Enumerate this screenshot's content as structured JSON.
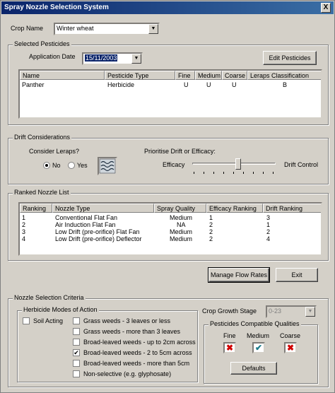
{
  "window": {
    "title": "Spray Nozzle Selection System",
    "close_label": "X"
  },
  "crop": {
    "label": "Crop Name",
    "value": "Winter wheat"
  },
  "selected_pesticides": {
    "group_title": "Selected Pesticides",
    "application_date_label": "Application Date",
    "application_date_value": "15/11/2003",
    "edit_button": "Edit Pesticides",
    "columns": [
      "Name",
      "Pesticide Type",
      "Fine",
      "Medium",
      "Coarse",
      "Leraps Classification"
    ],
    "rows": [
      [
        "Panther",
        "Herbicide",
        "U",
        "U",
        "U",
        "B"
      ]
    ]
  },
  "drift": {
    "group_title": "Drift Considerations",
    "consider_leraps_label": "Consider Leraps?",
    "no_label": "No",
    "yes_label": "Yes",
    "selected": "No",
    "prioritise_label": "Prioritise Drift or Efficacy:",
    "efficacy_label": "Efficacy",
    "drift_control_label": "Drift Control",
    "slider_position": 0.55
  },
  "ranked": {
    "group_title": "Ranked Nozzle List",
    "columns": [
      "Ranking",
      "Nozzle Type",
      "Spray Quality",
      "Efficacy Ranking",
      "Drift Ranking"
    ],
    "rows": [
      [
        "1",
        "Conventional Flat Fan",
        "Medium",
        "1",
        "3"
      ],
      [
        "2",
        "Air Induction Flat Fan",
        "NA",
        "2",
        "1"
      ],
      [
        "3",
        "Low Drift (pre-orifice) Flat Fan",
        "Medium",
        "2",
        "2"
      ],
      [
        "4",
        "Low Drift (pre-orifice) Deflector",
        "Medium",
        "2",
        "4"
      ]
    ]
  },
  "actions": {
    "manage_flow_rates": "Manage Flow Rates",
    "exit": "Exit"
  },
  "criteria": {
    "group_title": "Nozzle Selection Criteria",
    "herbicide_group_title": "Herbicide Modes of Action",
    "soil_acting_label": "Soil Acting",
    "soil_acting_checked": false,
    "modes": [
      {
        "label": "Grass weeds - 3 leaves or less",
        "checked": false
      },
      {
        "label": "Grass weeds - more than 3 leaves",
        "checked": false
      },
      {
        "label": "Broad-leaved weeds - up to 2cm across",
        "checked": false
      },
      {
        "label": "Broad-leaved weeds - 2 to 5cm across",
        "checked": true
      },
      {
        "label": "Broad-leaved weeds - more than 5cm",
        "checked": false
      },
      {
        "label": "Non-selective (e.g. glyphosate)",
        "checked": false
      }
    ],
    "crop_growth_stage_label": "Crop Growth Stage",
    "crop_growth_stage_value": "0-23",
    "compatible_group_title": "Pesticides Compatible Qualities",
    "qualities": [
      {
        "label": "Fine",
        "state": "cross"
      },
      {
        "label": "Medium",
        "state": "tick"
      },
      {
        "label": "Coarse",
        "state": "cross"
      }
    ],
    "defaults_button": "Defaults"
  },
  "colors": {
    "cross": "#d00000",
    "tick": "#1a7a8a",
    "title_start": "#0a246a",
    "title_end": "#3a6ea5"
  }
}
